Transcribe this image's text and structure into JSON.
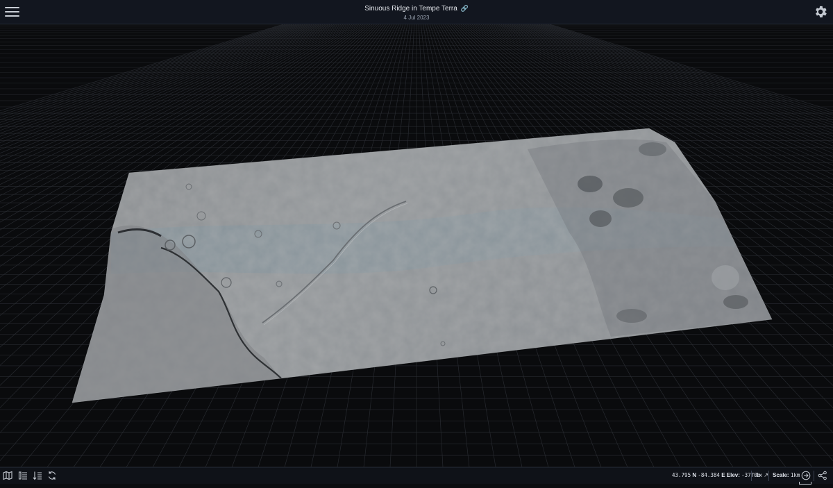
{
  "header": {
    "title": "Sinuous Ridge in Tempe Terra",
    "title_icon": "link-icon",
    "date": "4 Jul 2023",
    "menu_icon": "hamburger-menu-icon",
    "settings_icon": "gear-icon"
  },
  "footer": {
    "left_icons": [
      "map-icon",
      "list-icon",
      "list-sort-icon",
      "refresh-icon"
    ],
    "lat_value": "43.795",
    "lat_dir": "N",
    "lon_value": "-84.384",
    "lon_dir": "E",
    "elev_label": "Elev:",
    "elev_value": "-3770m",
    "zoom_value": "1x",
    "zoom_icon": "expand-arrow-icon",
    "scale_label": "Scale:",
    "scale_value": "1km",
    "right_icons": [
      "scale-bar-icon",
      "arrow-right-circle-icon",
      "share-icon"
    ]
  },
  "colors": {
    "topbar_bg": "#12161f",
    "viewport_bg": "#0a0b0d",
    "grid_line": "#2a2d33",
    "terrain_base": "#8e9194",
    "terrain_blue_tint": "#7f929c"
  }
}
